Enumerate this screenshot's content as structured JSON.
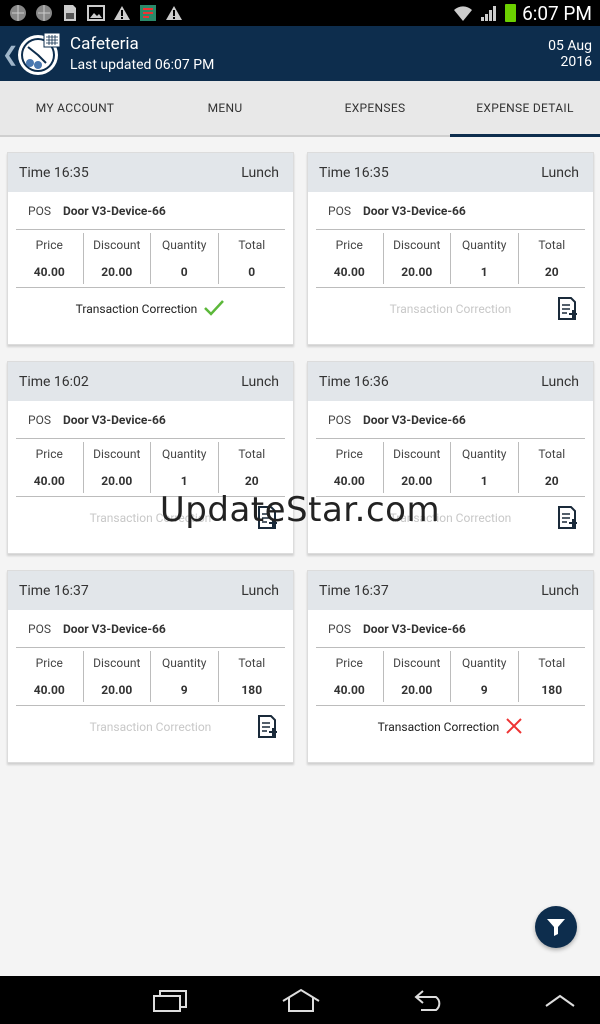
{
  "status": {
    "time": "6:07 PM"
  },
  "header": {
    "title": "Cafeteria",
    "subtitle": "Last updated 06:07 PM",
    "date_line1": "05 Aug",
    "date_line2": "2016"
  },
  "tabs": [
    {
      "label": "MY ACCOUNT"
    },
    {
      "label": "MENU"
    },
    {
      "label": "EXPENSES"
    },
    {
      "label": "EXPENSE DETAIL",
      "active": true
    }
  ],
  "labels": {
    "pos": "POS",
    "price": "Price",
    "discount": "Discount",
    "quantity": "Quantity",
    "total": "Total",
    "correction": "Transaction Correction"
  },
  "cards": [
    {
      "time": "Time  16:35",
      "meal": "Lunch",
      "pos": "Door V3-Device-66",
      "price": "40.00",
      "discount": "20.00",
      "quantity": "0",
      "total": "0",
      "correction_status": "accepted"
    },
    {
      "time": "Time  16:35",
      "meal": "Lunch",
      "pos": "Door V3-Device-66",
      "price": "40.00",
      "discount": "20.00",
      "quantity": "1",
      "total": "20",
      "correction_status": "none"
    },
    {
      "time": "Time  16:02",
      "meal": "Lunch",
      "pos": "Door V3-Device-66",
      "price": "40.00",
      "discount": "20.00",
      "quantity": "1",
      "total": "20",
      "correction_status": "none"
    },
    {
      "time": "Time  16:36",
      "meal": "Lunch",
      "pos": "Door V3-Device-66",
      "price": "40.00",
      "discount": "20.00",
      "quantity": "1",
      "total": "20",
      "correction_status": "none"
    },
    {
      "time": "Time  16:37",
      "meal": "Lunch",
      "pos": "Door V3-Device-66",
      "price": "40.00",
      "discount": "20.00",
      "quantity": "9",
      "total": "180",
      "correction_status": "none"
    },
    {
      "time": "Time  16:37",
      "meal": "Lunch",
      "pos": "Door V3-Device-66",
      "price": "40.00",
      "discount": "20.00",
      "quantity": "9",
      "total": "180",
      "correction_status": "rejected"
    }
  ],
  "watermark": "UpdateStar.com",
  "colors": {
    "primary": "#0d2d4d",
    "accepted": "#5cb83a",
    "rejected": "#ee3333",
    "card_header_bg": "#e2e6ea"
  }
}
